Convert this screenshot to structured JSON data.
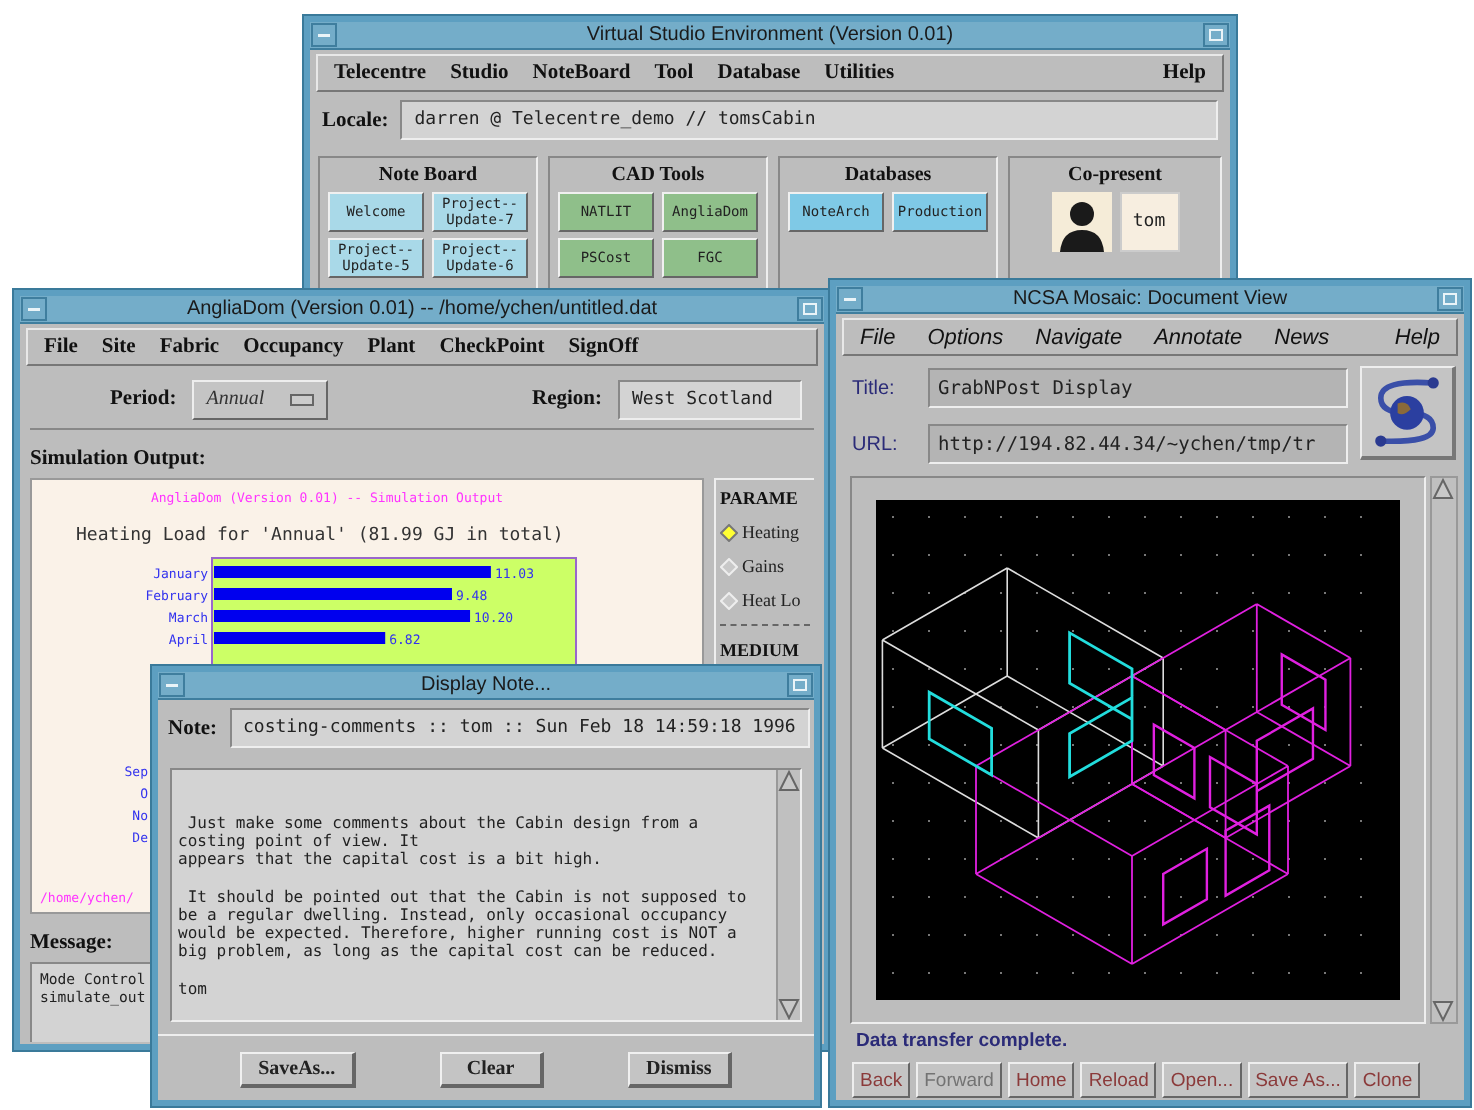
{
  "vse": {
    "title": "Virtual Studio Environment (Version 0.01)",
    "menu": [
      "Telecentre",
      "Studio",
      "NoteBoard",
      "Tool",
      "Database",
      "Utilities"
    ],
    "help": "Help",
    "locale_label": "Locale:",
    "locale": "darren @ Telecentre_demo // tomsCabin",
    "groups": [
      {
        "title": "Note Board",
        "kind": "notes",
        "buttons": [
          "Welcome",
          "Project--\nUpdate-7",
          "Project--\nUpdate-5",
          "Project--\nUpdate-6"
        ]
      },
      {
        "title": "CAD Tools",
        "kind": "tools",
        "buttons": [
          "NATLIT",
          "AngliaDom",
          "PSCost",
          "FGC"
        ]
      },
      {
        "title": "Databases",
        "kind": "databases",
        "buttons": [
          "NoteArch",
          "Production"
        ]
      },
      {
        "title": "Co-present",
        "kind": "people",
        "buttons": [
          "tom"
        ]
      }
    ]
  },
  "anglia": {
    "title": "AngliaDom (Version 0.01) -- /home/ychen/untitled.dat",
    "menu": [
      "File",
      "Site",
      "Fabric",
      "Occupancy",
      "Plant",
      "CheckPoint",
      "SignOff"
    ],
    "period_label": "Period:",
    "period": "Annual",
    "region_label": "Region:",
    "region": "West Scotland",
    "output_label": "Simulation Output:",
    "output": {
      "header": "AngliaDom (Version 0.01) --  Simulation Output",
      "heading": "Heating Load for 'Annual' (81.99 GJ in total)",
      "chart_data": {
        "type": "bar",
        "orientation": "horizontal",
        "categories": [
          "January",
          "February",
          "March",
          "April"
        ],
        "series": [
          {
            "color": "#0000ee",
            "values": [
              11.03,
              9.48,
              10.2,
              6.82
            ],
            "value_labels": [
              "11.03",
              "9.48",
              "10.20",
              "6.82"
            ]
          }
        ],
        "data_labels": true
      },
      "covered_labels": [
        "Sep",
        "O",
        "No",
        "De"
      ],
      "path": "/home/ychen/"
    },
    "params": {
      "title": "PARAME",
      "options": [
        {
          "label": "Heating",
          "selected": true
        },
        {
          "label": "Gains",
          "selected": false
        },
        {
          "label": "Heat Lo",
          "selected": false
        }
      ],
      "section": "MEDIUM"
    },
    "message_label": "Message:",
    "message": "Mode Control\nsimulate_out"
  },
  "note": {
    "title": "Display Note...",
    "note_label": "Note:",
    "note": "costing-comments :: tom :: Sun Feb 18 14:59:18 1996",
    "body": " Just make some comments about the Cabin design from a\ncosting point of view. It\nappears that the capital cost is a bit high.\n\n It should be pointed out that the Cabin is not supposed to\nbe a regular dwelling. Instead, only occasional occupancy\nwould be expected. Therefore, higher running cost is NOT a\nbig problem, as long as the capital cost can be reduced.\n\ntom",
    "buttons": [
      "SaveAs...",
      "Clear",
      "Dismiss"
    ]
  },
  "mosaic": {
    "title": "NCSA Mosaic: Document View",
    "menu": [
      "File",
      "Options",
      "Navigate",
      "Annotate",
      "News"
    ],
    "help": "Help",
    "title_label": "Title:",
    "doc_title": "GrabNPost Display",
    "url_label": "URL:",
    "url": "http://194.82.44.34/~ychen/tmp/tr",
    "status": "Data transfer complete.",
    "buttons": [
      {
        "label": "Back",
        "disabled": false
      },
      {
        "label": "Forward",
        "disabled": true
      },
      {
        "label": "Home",
        "disabled": false
      },
      {
        "label": "Reload",
        "disabled": false
      },
      {
        "label": "Open...",
        "disabled": false
      },
      {
        "label": "Save As...",
        "disabled": false
      },
      {
        "label": "Clone",
        "disabled": false
      }
    ]
  }
}
